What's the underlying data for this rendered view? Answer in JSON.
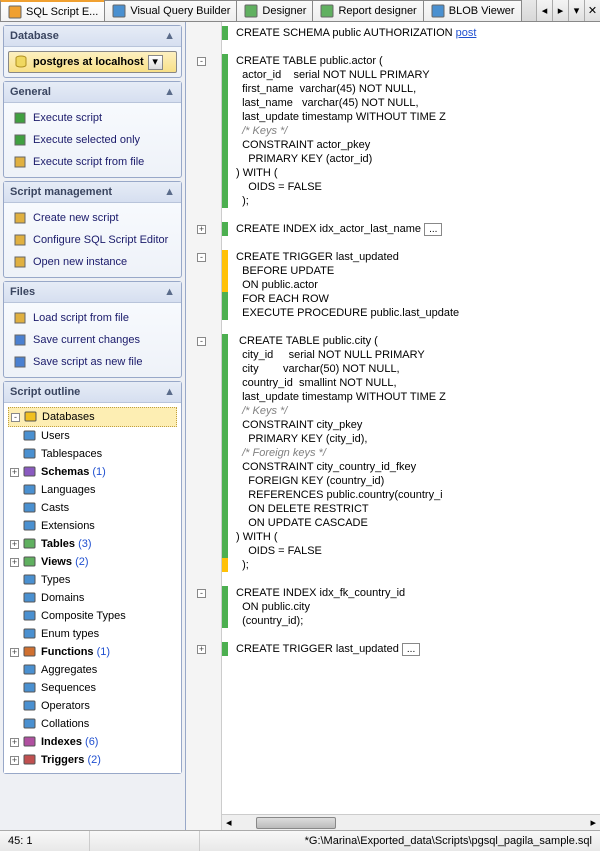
{
  "tabs": {
    "items": [
      {
        "label": "SQL Script E...",
        "active": true
      },
      {
        "label": "Visual Query Builder",
        "active": false
      },
      {
        "label": "Designer",
        "active": false
      },
      {
        "label": "Report designer",
        "active": false
      },
      {
        "label": "BLOB Viewer",
        "active": false
      }
    ]
  },
  "panels": {
    "database": {
      "title": "Database",
      "value": "postgres at localhost"
    },
    "general": {
      "title": "General",
      "items": [
        "Execute script",
        "Execute selected only",
        "Execute script from file"
      ]
    },
    "script_mgmt": {
      "title": "Script management",
      "items": [
        "Create new script",
        "Configure SQL Script Editor",
        "Open new instance"
      ]
    },
    "files": {
      "title": "Files",
      "items": [
        "Load script from file",
        "Save current changes",
        "Save script as new file"
      ]
    },
    "outline": {
      "title": "Script outline",
      "tree": [
        {
          "exp": "-",
          "label": "Databases",
          "sel": true,
          "cnt": ""
        },
        {
          "exp": "",
          "label": "Users",
          "cnt": ""
        },
        {
          "exp": "",
          "label": "Tablespaces",
          "cnt": ""
        },
        {
          "exp": "+",
          "label": "Schemas",
          "cnt": "(1)",
          "bold": true
        },
        {
          "exp": "",
          "label": "Languages",
          "cnt": ""
        },
        {
          "exp": "",
          "label": "Casts",
          "cnt": ""
        },
        {
          "exp": "",
          "label": "Extensions",
          "cnt": ""
        },
        {
          "exp": "+",
          "label": "Tables",
          "cnt": "(3)",
          "bold": true
        },
        {
          "exp": "+",
          "label": "Views",
          "cnt": "(2)",
          "bold": true
        },
        {
          "exp": "",
          "label": "Types",
          "cnt": ""
        },
        {
          "exp": "",
          "label": "Domains",
          "cnt": ""
        },
        {
          "exp": "",
          "label": "Composite Types",
          "cnt": ""
        },
        {
          "exp": "",
          "label": "Enum types",
          "cnt": ""
        },
        {
          "exp": "+",
          "label": "Functions",
          "cnt": "(1)",
          "bold": true
        },
        {
          "exp": "",
          "label": "Aggregates",
          "cnt": ""
        },
        {
          "exp": "",
          "label": "Sequences",
          "cnt": ""
        },
        {
          "exp": "",
          "label": "Operators",
          "cnt": ""
        },
        {
          "exp": "",
          "label": "Collations",
          "cnt": ""
        },
        {
          "exp": "+",
          "label": "Indexes",
          "cnt": "(6)",
          "bold": true
        },
        {
          "exp": "+",
          "label": "Triggers",
          "cnt": "(2)",
          "bold": true
        }
      ]
    }
  },
  "code": {
    "lines": [
      {
        "c": "g",
        "t": "CREATE SCHEMA public AUTHORIZATION ",
        "link": "post"
      },
      {
        "c": "",
        "t": ""
      },
      {
        "c": "g",
        "t": "CREATE TABLE public.actor (",
        "fold": "-"
      },
      {
        "c": "g",
        "t": "  actor_id    serial NOT NULL PRIMARY "
      },
      {
        "c": "g",
        "t": "  first_name  varchar(45) NOT NULL,"
      },
      {
        "c": "g",
        "t": "  last_name   varchar(45) NOT NULL,"
      },
      {
        "c": "g",
        "t": "  last_update timestamp WITHOUT TIME Z"
      },
      {
        "c": "g",
        "t": "  /* Keys */",
        "cm": true
      },
      {
        "c": "g",
        "t": "  CONSTRAINT actor_pkey"
      },
      {
        "c": "g",
        "t": "    PRIMARY KEY (actor_id)"
      },
      {
        "c": "g",
        "t": ") WITH ("
      },
      {
        "c": "g",
        "t": "    OIDS = FALSE"
      },
      {
        "c": "g",
        "t": "  );"
      },
      {
        "c": "",
        "t": ""
      },
      {
        "c": "g",
        "t": "CREATE INDEX idx_actor_last_name ",
        "box": "...",
        "fold": "+"
      },
      {
        "c": "",
        "t": ""
      },
      {
        "c": "y",
        "t": "CREATE TRIGGER last_updated",
        "fold": "-"
      },
      {
        "c": "y",
        "t": "  BEFORE UPDATE"
      },
      {
        "c": "y",
        "t": "  ON public.actor"
      },
      {
        "c": "g",
        "t": "  FOR EACH ROW"
      },
      {
        "c": "g",
        "t": "  EXECUTE PROCEDURE public.last_update"
      },
      {
        "c": "",
        "t": ""
      },
      {
        "c": "g",
        "t": " CREATE TABLE public.city (",
        "fold": "-"
      },
      {
        "c": "g",
        "t": "  city_id     serial NOT NULL PRIMARY "
      },
      {
        "c": "g",
        "t": "  city        varchar(50) NOT NULL,"
      },
      {
        "c": "g",
        "t": "  country_id  smallint NOT NULL,"
      },
      {
        "c": "g",
        "t": "  last_update timestamp WITHOUT TIME Z"
      },
      {
        "c": "g",
        "t": "  /* Keys */",
        "cm": true
      },
      {
        "c": "g",
        "t": "  CONSTRAINT city_pkey"
      },
      {
        "c": "g",
        "t": "    PRIMARY KEY (city_id),"
      },
      {
        "c": "g",
        "t": "  /* Foreign keys */",
        "cm": true
      },
      {
        "c": "g",
        "t": "  CONSTRAINT city_country_id_fkey"
      },
      {
        "c": "g",
        "t": "    FOREIGN KEY (country_id)"
      },
      {
        "c": "g",
        "t": "    REFERENCES public.country(country_i"
      },
      {
        "c": "g",
        "t": "    ON DELETE RESTRICT"
      },
      {
        "c": "g",
        "t": "    ON UPDATE CASCADE"
      },
      {
        "c": "g",
        "t": ") WITH ("
      },
      {
        "c": "g",
        "t": "    OIDS = FALSE"
      },
      {
        "c": "y",
        "t": "  );"
      },
      {
        "c": "",
        "t": ""
      },
      {
        "c": "g",
        "t": "CREATE INDEX idx_fk_country_id",
        "fold": "-"
      },
      {
        "c": "g",
        "t": "  ON public.city"
      },
      {
        "c": "g",
        "t": "  (country_id);"
      },
      {
        "c": "",
        "t": ""
      },
      {
        "c": "g",
        "t": "CREATE TRIGGER last_updated ",
        "box": "...",
        "fold": "+"
      },
      {
        "c": "",
        "t": ""
      }
    ]
  },
  "status": {
    "pos": "45:   1",
    "path": "*G:\\Marina\\Exported_data\\Scripts\\pgsql_pagila_sample.sql"
  },
  "tree_icon_colors": [
    "#f0c020",
    "#4a90d0",
    "#4a90d0",
    "#8a5ac0",
    "#4a90d0",
    "#4a90d0",
    "#4a90d0",
    "#60b060",
    "#60b060",
    "#4a90d0",
    "#4a90d0",
    "#4a90d0",
    "#4a90d0",
    "#d07030",
    "#4a90d0",
    "#4a90d0",
    "#4a90d0",
    "#4a90d0",
    "#b050a0",
    "#c05050"
  ]
}
